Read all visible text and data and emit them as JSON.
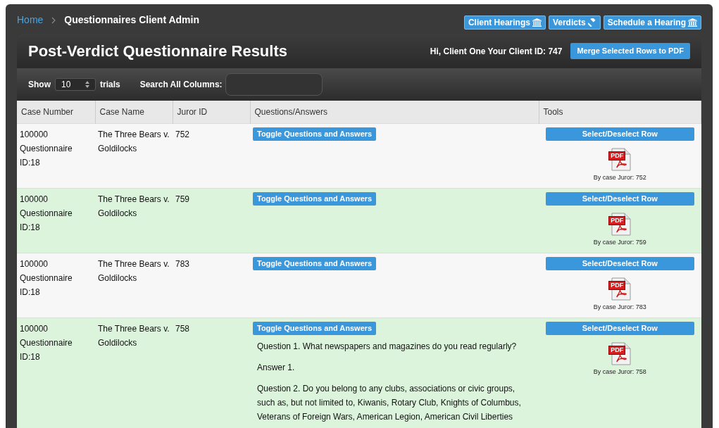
{
  "breadcrumb": [
    "Home",
    "Questionnaires Client Admin"
  ],
  "nav_buttons": [
    {
      "label": "Client Hearings",
      "kind": "building"
    },
    {
      "label": "Verdicts",
      "kind": "gavel"
    },
    {
      "label": "Schedule a Hearing",
      "kind": "building"
    }
  ],
  "header": {
    "title": "Post-Verdict Questionnaire Results",
    "greeting": "Hi, Client One Your Client ID: 747",
    "merge_button": "Merge Selected Rows to PDF"
  },
  "toolbar": {
    "show_label": "Show",
    "page_size": "10",
    "trials_label": "trials",
    "search_label": "Search All Columns:"
  },
  "table": {
    "columns": [
      "Case Number",
      "Case Name",
      "Juror ID",
      "Questions/Answers",
      "Tools"
    ],
    "rows": [
      {
        "case_number": [
          "100000",
          "Questionnaire",
          "ID:18"
        ],
        "case_name": [
          "The Three Bears v.",
          "Goldilocks"
        ],
        "juror_id": "752",
        "toggle": "Toggle Questions and Answers",
        "select": "Select/Deselect Row",
        "pdf_badge": "PDF",
        "pdf_caption": "By case Juror: 752",
        "selected": false
      },
      {
        "case_number": [
          "100000",
          "Questionnaire",
          "ID:18"
        ],
        "case_name": [
          "The Three Bears v.",
          "Goldilocks"
        ],
        "juror_id": "759",
        "toggle": "Toggle Questions and Answers",
        "select": "Select/Deselect Row",
        "pdf_badge": "PDF",
        "pdf_caption": "By case Juror: 759",
        "selected": true
      },
      {
        "case_number": [
          "100000",
          "Questionnaire",
          "ID:18"
        ],
        "case_name": [
          "The Three Bears v.",
          "Goldilocks"
        ],
        "juror_id": "783",
        "toggle": "Toggle Questions and Answers",
        "select": "Select/Deselect Row",
        "pdf_badge": "PDF",
        "pdf_caption": "By case Juror: 783",
        "selected": false
      },
      {
        "case_number": [
          "100000",
          "Questionnaire",
          "ID:18"
        ],
        "case_name": [
          "The Three Bears v.",
          "Goldilocks"
        ],
        "juror_id": "758",
        "toggle": "Toggle Questions and Answers",
        "select": "Select/Deselect Row",
        "pdf_badge": "PDF",
        "pdf_caption": "By case Juror: 758",
        "selected": true,
        "qa": [
          "Question 1. What newspapers and magazines do you read regularly?",
          "Answer 1.",
          "Question 2. Do you belong to any clubs, associations or civic groups, such as, but not limited to, Kiwanis, Rotary Club, Knights of Columbus, Veterans of Foreign Wars, American Legion, American Civil Liberties"
        ]
      }
    ]
  }
}
